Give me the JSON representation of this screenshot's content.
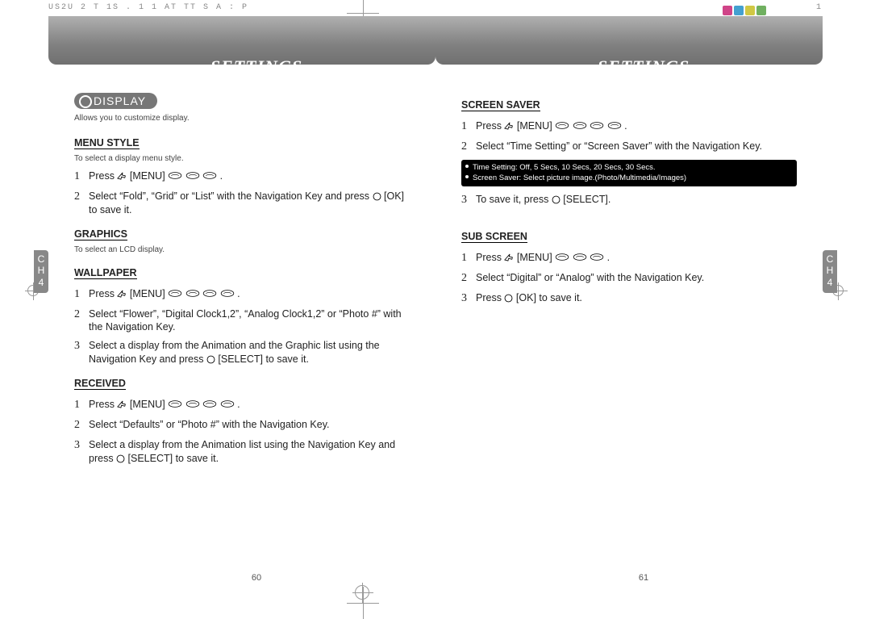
{
  "top_code": "US2U  2 T  1S .   1 1 AT  TT  S   A : P",
  "top_right_num": "1",
  "header_title": "SETTINGS",
  "ch_label": "C\nH\n4",
  "page_numbers": {
    "left": "60",
    "right": "61"
  },
  "display": {
    "badge": "DISPLAY",
    "intro": "Allows you to customize display."
  },
  "menu_style": {
    "title": "MENU STYLE",
    "note": "To select a display menu style.",
    "steps": [
      {
        "prefix": "Press ",
        "menu": "[MENU]",
        "keys": 3,
        "suffix": "."
      },
      {
        "text": "Select “Fold”, “Grid” or “List” with the Navigation Key and press ",
        "round": true,
        "tail": " [OK] to save it."
      }
    ]
  },
  "graphics": {
    "title": "GRAPHICS",
    "note": "To select an LCD display."
  },
  "wallpaper": {
    "title": "WALLPAPER",
    "steps": [
      {
        "prefix": "Press ",
        "menu": "[MENU]",
        "keys": 4,
        "suffix": "."
      },
      {
        "text": "Select “Flower”, “Digital Clock1,2”, “Analog Clock1,2” or “Photo #” with the Navigation Key."
      },
      {
        "text": "Select a display from the Animation and the Graphic list using the Navigation Key and press ",
        "round": true,
        "tail": " [SELECT] to save it."
      }
    ]
  },
  "received": {
    "title": "RECEIVED",
    "steps": [
      {
        "prefix": "Press ",
        "menu": "[MENU]",
        "keys": 4,
        "suffix": "."
      },
      {
        "text": "Select “Defaults” or “Photo #” with the Navigation Key."
      },
      {
        "text": "Select a display from the Animation list using the Navigation Key and press ",
        "round": true,
        "tail": " [SELECT] to save it."
      }
    ]
  },
  "screen_saver": {
    "title": "SCREEN SAVER",
    "steps": [
      {
        "prefix": "Press ",
        "menu": "[MENU]",
        "keys": 4,
        "suffix": "."
      },
      {
        "text": "Select “Time Setting” or “Screen Saver” with the Navigation Key."
      },
      {
        "prefix": "To save it, press ",
        "round": true,
        "tail": " [SELECT]."
      }
    ],
    "note_lines": [
      "Time Setting: Off, 5 Secs, 10 Secs, 20 Secs, 30 Secs.",
      "Screen Saver: Select picture image.(Photo/Multimedia/Images)"
    ]
  },
  "sub_screen": {
    "title": "SUB SCREEN",
    "steps": [
      {
        "prefix": "Press ",
        "menu": "[MENU]",
        "keys": 3,
        "suffix": "."
      },
      {
        "text": "Select “Digital” or “Analog” with the Navigation Key."
      },
      {
        "prefix": "Press ",
        "round": true,
        "tail": " [OK] to save it."
      }
    ]
  }
}
